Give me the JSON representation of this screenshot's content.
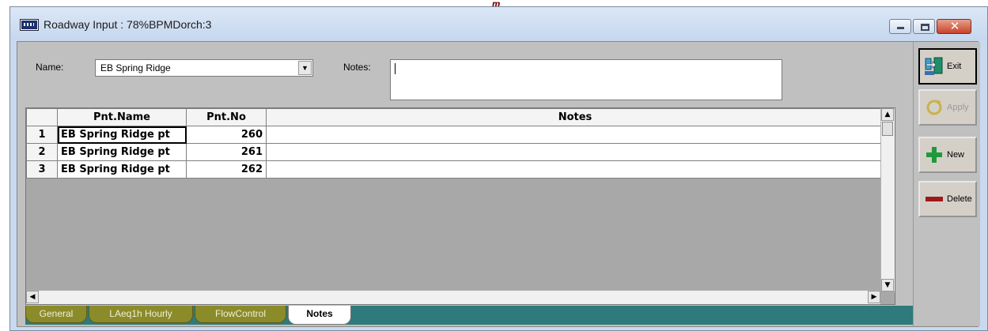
{
  "window": {
    "title": "Roadway Input : 78%BPMDorch:3"
  },
  "titlebar_glyph": "m",
  "controls": {
    "close": "✕"
  },
  "form": {
    "name_label": "Name:",
    "name_value": "EB Spring Ridge",
    "notes_label": "Notes:",
    "notes_value": ""
  },
  "grid": {
    "columns": [
      "Pnt.Name",
      "Pnt.No",
      "Notes"
    ],
    "rows": [
      {
        "num": "1",
        "name": "EB Spring Ridge pt",
        "no": "260",
        "notes": ""
      },
      {
        "num": "2",
        "name": "EB Spring Ridge pt",
        "no": "261",
        "notes": ""
      },
      {
        "num": "3",
        "name": "EB Spring Ridge pt",
        "no": "262",
        "notes": ""
      }
    ]
  },
  "tabs": [
    {
      "label": "General",
      "active": false
    },
    {
      "label": "LAeq1h Hourly",
      "active": false
    },
    {
      "label": "FlowControl",
      "active": false
    },
    {
      "label": "Notes",
      "active": true
    }
  ],
  "side_buttons": {
    "exit": "Exit",
    "apply": "Apply",
    "new": "New",
    "delete": "Delete"
  }
}
